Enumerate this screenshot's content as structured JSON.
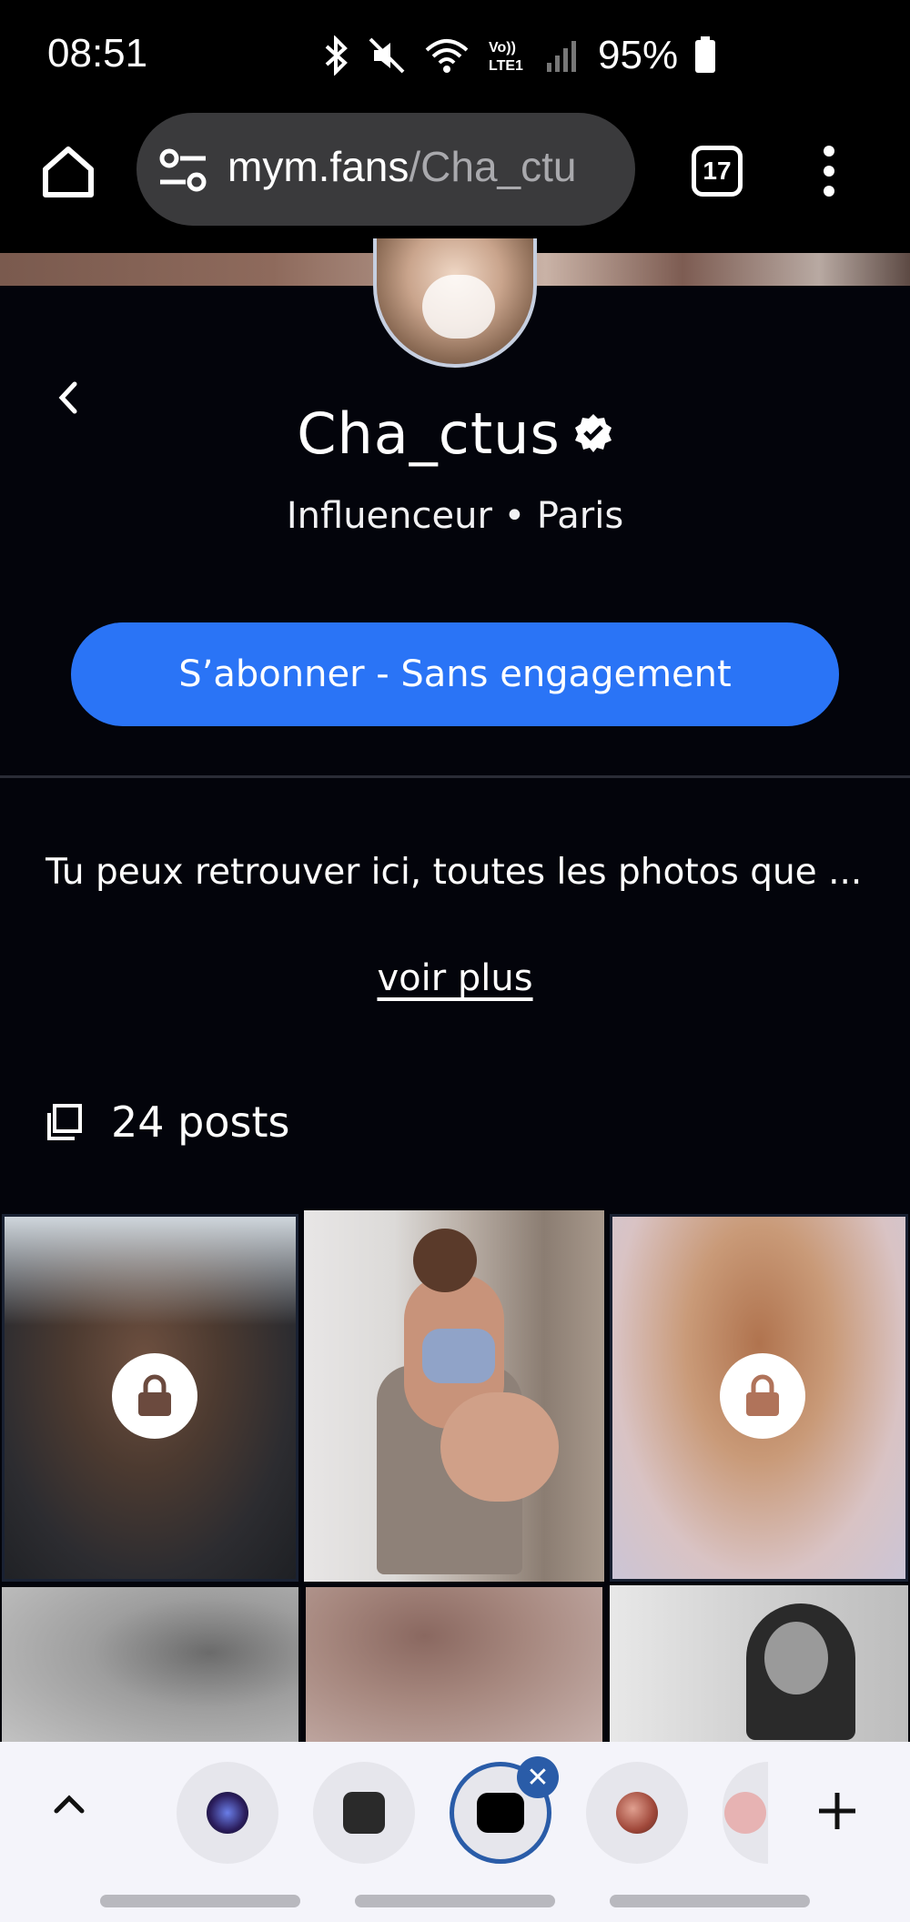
{
  "status_bar": {
    "time": "08:51",
    "battery": "95%"
  },
  "browser": {
    "url_domain": "mym.fans",
    "url_path": "/Cha_ctu",
    "tab_count": "17"
  },
  "profile": {
    "name": "Cha_ctus",
    "meta": "Influenceur • Paris",
    "subscribe_label": "S’abonner - Sans engagement",
    "bio": "Tu peux retrouver ici, toutes les photos que ...",
    "see_more_label": "voir plus",
    "posts_count": "24 posts"
  },
  "colors": {
    "background": "#03040b",
    "accent": "#2a74f6",
    "tab_active": "#2a5ca8"
  },
  "icons": {
    "home": "home-icon",
    "site_settings": "tune-icon",
    "menu": "more-vert-icon",
    "back": "chevron-left-icon",
    "verified": "verified-badge-icon",
    "posts": "copy-icon",
    "lock": "lock-icon",
    "collapse": "chevron-up-icon",
    "add_tab": "plus-icon",
    "close_tab": "close-icon"
  }
}
